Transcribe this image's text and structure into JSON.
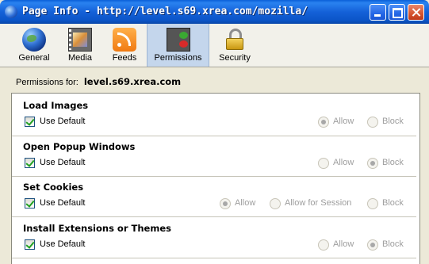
{
  "window": {
    "title": "Page Info - http://level.s69.xrea.com/mozilla/"
  },
  "tabs": [
    {
      "label": "General",
      "icon": "globe-icon"
    },
    {
      "label": "Media",
      "icon": "media-icon"
    },
    {
      "label": "Feeds",
      "icon": "feed-icon"
    },
    {
      "label": "Permissions",
      "icon": "permissions-icon",
      "active": true
    },
    {
      "label": "Security",
      "icon": "padlock-icon"
    }
  ],
  "header": {
    "label": "Permissions for:",
    "host": "level.s69.xrea.com"
  },
  "permissions": [
    {
      "title": "Load Images",
      "use_default": "Use Default",
      "use_default_checked": true,
      "options": [
        "Allow",
        "Block"
      ],
      "selected": "Allow"
    },
    {
      "title": "Open Popup Windows",
      "use_default": "Use Default",
      "use_default_checked": true,
      "options": [
        "Allow",
        "Block"
      ],
      "selected": "Block"
    },
    {
      "title": "Set Cookies",
      "use_default": "Use Default",
      "use_default_checked": true,
      "options": [
        "Allow",
        "Allow for Session",
        "Block"
      ],
      "selected": "Allow"
    },
    {
      "title": "Install Extensions or Themes",
      "use_default": "Use Default",
      "use_default_checked": true,
      "options": [
        "Allow",
        "Block"
      ],
      "selected": "Block"
    }
  ],
  "colors": {
    "titlebar": "#0b55c8",
    "active_tab": "#c4d6ec",
    "dialog_bg": "#ece9d8"
  }
}
